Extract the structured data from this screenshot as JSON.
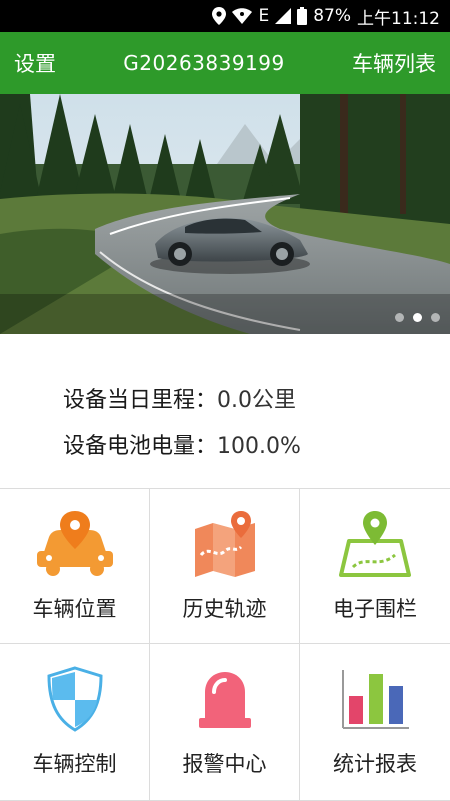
{
  "status_bar": {
    "battery": "87%",
    "time": "上午11:12",
    "network": "E"
  },
  "header": {
    "left_button": "设置",
    "title": "G20263839199",
    "right_button": "车辆列表",
    "color": "#2e9a2a"
  },
  "banner": {
    "slides_count": 3,
    "active_slide": 2
  },
  "info": {
    "mileage_label": "设备当日里程：",
    "mileage_value": "0.0公里",
    "battery_label": "设备电池电量：",
    "battery_value": "100.0%"
  },
  "menu": [
    {
      "label": "车辆位置",
      "icon": "car-location-icon"
    },
    {
      "label": "历史轨迹",
      "icon": "map-track-icon"
    },
    {
      "label": "电子围栏",
      "icon": "geofence-icon"
    },
    {
      "label": "车辆控制",
      "icon": "shield-icon"
    },
    {
      "label": "报警中心",
      "icon": "alarm-light-icon"
    },
    {
      "label": "统计报表",
      "icon": "bar-chart-icon"
    }
  ]
}
